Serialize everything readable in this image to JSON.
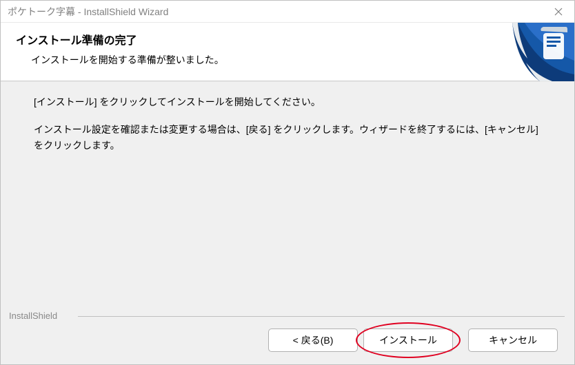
{
  "titlebar": {
    "title": "ポケトーク字幕 - InstallShield Wizard"
  },
  "header": {
    "title": "インストール準備の完了",
    "subtitle": "インストールを開始する準備が整いました。"
  },
  "content": {
    "line1": "[インストール] をクリックしてインストールを開始してください。",
    "line2": "インストール設定を確認または変更する場合は、[戻る] をクリックします。ウィザードを終了するには、[キャンセル]をクリックします。"
  },
  "footer": {
    "brand": "InstallShield",
    "back": "< 戻る(B)",
    "install": "インストール",
    "cancel": "キャンセル"
  }
}
